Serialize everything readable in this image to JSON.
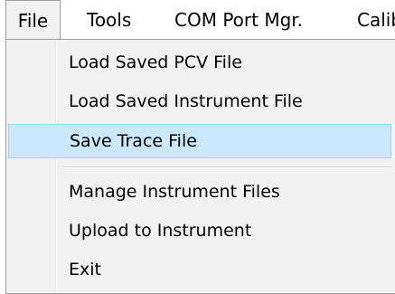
{
  "menubar": {
    "items": [
      {
        "label": "File",
        "state": "open"
      },
      {
        "label": "Tools"
      },
      {
        "label": "COM Port Mgr."
      },
      {
        "label": "Calib"
      }
    ]
  },
  "file_menu": {
    "items": [
      {
        "label": "Load Saved PCV File"
      },
      {
        "label": "Load Saved Instrument File"
      },
      {
        "label": "Save Trace File",
        "highlighted": true
      },
      {
        "label": "Manage Instrument Files"
      },
      {
        "label": "Upload to Instrument"
      },
      {
        "label": "Exit"
      }
    ]
  },
  "colors": {
    "highlight_fill": "#cce8ff",
    "highlight_border": "#99d1ff",
    "menu_background": "#f2f2f2",
    "border": "#9b9b9b"
  }
}
